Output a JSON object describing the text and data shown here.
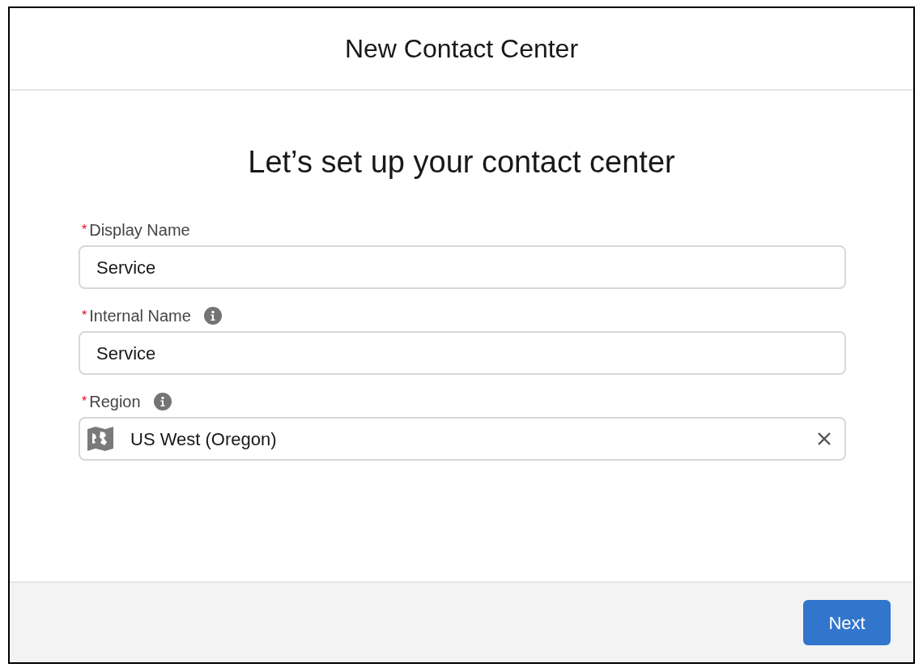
{
  "modal": {
    "title": "New Contact Center"
  },
  "heading": "Let’s set up your contact center",
  "fields": [
    {
      "kind": "text",
      "required_mark": "*",
      "label": "Display Name",
      "info": false,
      "value": "Service"
    },
    {
      "kind": "text",
      "required_mark": "*",
      "label": "Internal Name",
      "info": true,
      "value": "Service"
    },
    {
      "kind": "lookup",
      "required_mark": "*",
      "label": "Region",
      "info": true,
      "value": "US West (Oregon)"
    }
  ],
  "footer": {
    "buttons": [
      "Next"
    ]
  }
}
